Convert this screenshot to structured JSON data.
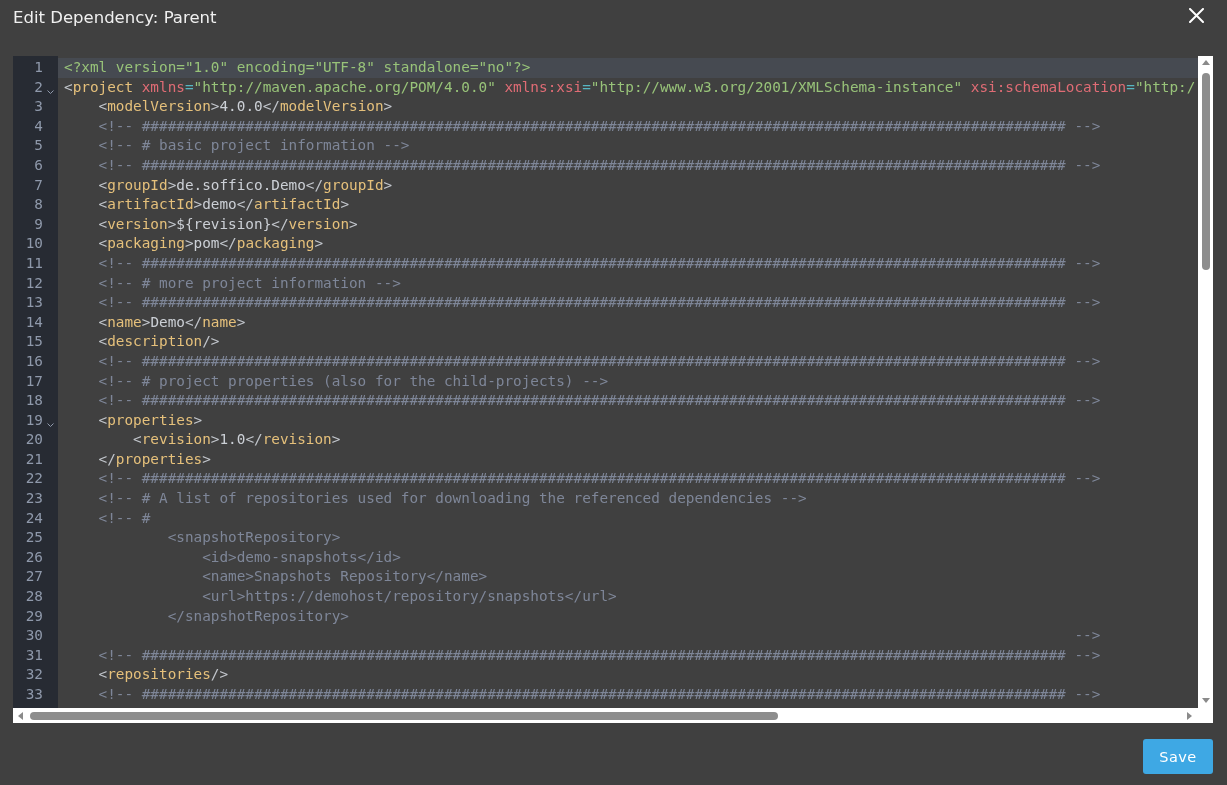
{
  "dialog": {
    "title": "Edit Dependency: Parent"
  },
  "editor": {
    "lines": [
      {
        "number": "1",
        "current": true,
        "foldable": false,
        "tokens": [
          {
            "kind": "declaration",
            "text": "<?xml version=\"1.0\" encoding=\"UTF-8\" standalone=\"no\"?>"
          }
        ]
      },
      {
        "number": "2",
        "current": false,
        "foldable": true,
        "tokens": [
          {
            "kind": "bracket",
            "text": "<"
          },
          {
            "kind": "tag",
            "text": "project"
          },
          {
            "kind": "attr",
            "text": " xmlns"
          },
          {
            "kind": "eq",
            "text": "="
          },
          {
            "kind": "value",
            "text": "\"http://maven.apache.org/POM/4.0.0\""
          },
          {
            "kind": "attr",
            "text": " xmlns:xsi"
          },
          {
            "kind": "eq",
            "text": "="
          },
          {
            "kind": "value",
            "text": "\"http://www.w3.org/2001/XMLSchema-instance\""
          },
          {
            "kind": "attr",
            "text": " xsi:schemaLocation"
          },
          {
            "kind": "eq",
            "text": "="
          },
          {
            "kind": "value",
            "text": "\"http:/"
          }
        ]
      },
      {
        "number": "3",
        "current": false,
        "foldable": false,
        "tokens": [
          {
            "kind": "bracket",
            "text": "    <"
          },
          {
            "kind": "tag",
            "text": "modelVersion"
          },
          {
            "kind": "bracket",
            "text": ">"
          },
          {
            "kind": "text",
            "text": "4.0.0"
          },
          {
            "kind": "bracket",
            "text": "</"
          },
          {
            "kind": "tag",
            "text": "modelVersion"
          },
          {
            "kind": "bracket",
            "text": ">"
          }
        ]
      },
      {
        "number": "4",
        "current": false,
        "foldable": false,
        "tokens": [
          {
            "kind": "comment",
            "text": "    <!-- ########################################################################################################### -->"
          }
        ]
      },
      {
        "number": "5",
        "current": false,
        "foldable": false,
        "tokens": [
          {
            "kind": "comment",
            "text": "    <!-- # basic project information -->"
          }
        ]
      },
      {
        "number": "6",
        "current": false,
        "foldable": false,
        "tokens": [
          {
            "kind": "comment",
            "text": "    <!-- ########################################################################################################### -->"
          }
        ]
      },
      {
        "number": "7",
        "current": false,
        "foldable": false,
        "tokens": [
          {
            "kind": "bracket",
            "text": "    <"
          },
          {
            "kind": "tag",
            "text": "groupId"
          },
          {
            "kind": "bracket",
            "text": ">"
          },
          {
            "kind": "text",
            "text": "de.soffico.Demo"
          },
          {
            "kind": "bracket",
            "text": "</"
          },
          {
            "kind": "tag",
            "text": "groupId"
          },
          {
            "kind": "bracket",
            "text": ">"
          }
        ]
      },
      {
        "number": "8",
        "current": false,
        "foldable": false,
        "tokens": [
          {
            "kind": "bracket",
            "text": "    <"
          },
          {
            "kind": "tag",
            "text": "artifactId"
          },
          {
            "kind": "bracket",
            "text": ">"
          },
          {
            "kind": "text",
            "text": "demo"
          },
          {
            "kind": "bracket",
            "text": "</"
          },
          {
            "kind": "tag",
            "text": "artifactId"
          },
          {
            "kind": "bracket",
            "text": ">"
          }
        ]
      },
      {
        "number": "9",
        "current": false,
        "foldable": false,
        "tokens": [
          {
            "kind": "bracket",
            "text": "    <"
          },
          {
            "kind": "tag",
            "text": "version"
          },
          {
            "kind": "bracket",
            "text": ">"
          },
          {
            "kind": "text",
            "text": "${revision}"
          },
          {
            "kind": "bracket",
            "text": "</"
          },
          {
            "kind": "tag",
            "text": "version"
          },
          {
            "kind": "bracket",
            "text": ">"
          }
        ]
      },
      {
        "number": "10",
        "current": false,
        "foldable": false,
        "tokens": [
          {
            "kind": "bracket",
            "text": "    <"
          },
          {
            "kind": "tag",
            "text": "packaging"
          },
          {
            "kind": "bracket",
            "text": ">"
          },
          {
            "kind": "text",
            "text": "pom"
          },
          {
            "kind": "bracket",
            "text": "</"
          },
          {
            "kind": "tag",
            "text": "packaging"
          },
          {
            "kind": "bracket",
            "text": ">"
          }
        ]
      },
      {
        "number": "11",
        "current": false,
        "foldable": false,
        "tokens": [
          {
            "kind": "comment",
            "text": "    <!-- ########################################################################################################### -->"
          }
        ]
      },
      {
        "number": "12",
        "current": false,
        "foldable": false,
        "tokens": [
          {
            "kind": "comment",
            "text": "    <!-- # more project information -->"
          }
        ]
      },
      {
        "number": "13",
        "current": false,
        "foldable": false,
        "tokens": [
          {
            "kind": "comment",
            "text": "    <!-- ########################################################################################################### -->"
          }
        ]
      },
      {
        "number": "14",
        "current": false,
        "foldable": false,
        "tokens": [
          {
            "kind": "bracket",
            "text": "    <"
          },
          {
            "kind": "tag",
            "text": "name"
          },
          {
            "kind": "bracket",
            "text": ">"
          },
          {
            "kind": "text",
            "text": "Demo"
          },
          {
            "kind": "bracket",
            "text": "</"
          },
          {
            "kind": "tag",
            "text": "name"
          },
          {
            "kind": "bracket",
            "text": ">"
          }
        ]
      },
      {
        "number": "15",
        "current": false,
        "foldable": false,
        "tokens": [
          {
            "kind": "bracket",
            "text": "    <"
          },
          {
            "kind": "tag",
            "text": "description"
          },
          {
            "kind": "bracket",
            "text": "/>"
          }
        ]
      },
      {
        "number": "16",
        "current": false,
        "foldable": false,
        "tokens": [
          {
            "kind": "comment",
            "text": "    <!-- ########################################################################################################### -->"
          }
        ]
      },
      {
        "number": "17",
        "current": false,
        "foldable": false,
        "tokens": [
          {
            "kind": "comment",
            "text": "    <!-- # project properties (also for the child-projects) -->"
          }
        ]
      },
      {
        "number": "18",
        "current": false,
        "foldable": false,
        "tokens": [
          {
            "kind": "comment",
            "text": "    <!-- ########################################################################################################### -->"
          }
        ]
      },
      {
        "number": "19",
        "current": false,
        "foldable": true,
        "tokens": [
          {
            "kind": "bracket",
            "text": "    <"
          },
          {
            "kind": "tag",
            "text": "properties"
          },
          {
            "kind": "bracket",
            "text": ">"
          }
        ]
      },
      {
        "number": "20",
        "current": false,
        "foldable": false,
        "tokens": [
          {
            "kind": "bracket",
            "text": "        <"
          },
          {
            "kind": "tag",
            "text": "revision"
          },
          {
            "kind": "bracket",
            "text": ">"
          },
          {
            "kind": "text",
            "text": "1.0"
          },
          {
            "kind": "bracket",
            "text": "</"
          },
          {
            "kind": "tag",
            "text": "revision"
          },
          {
            "kind": "bracket",
            "text": ">"
          }
        ]
      },
      {
        "number": "21",
        "current": false,
        "foldable": false,
        "tokens": [
          {
            "kind": "bracket",
            "text": "    </"
          },
          {
            "kind": "tag",
            "text": "properties"
          },
          {
            "kind": "bracket",
            "text": ">"
          }
        ]
      },
      {
        "number": "22",
        "current": false,
        "foldable": false,
        "tokens": [
          {
            "kind": "comment",
            "text": "    <!-- ########################################################################################################### -->"
          }
        ]
      },
      {
        "number": "23",
        "current": false,
        "foldable": false,
        "tokens": [
          {
            "kind": "comment",
            "text": "    <!-- # A list of repositories used for downloading the referenced dependencies -->"
          }
        ]
      },
      {
        "number": "24",
        "current": false,
        "foldable": false,
        "tokens": [
          {
            "kind": "comment",
            "text": "    <!-- #"
          }
        ]
      },
      {
        "number": "25",
        "current": false,
        "foldable": false,
        "tokens": [
          {
            "kind": "comment",
            "text": "            <snapshotRepository>"
          }
        ]
      },
      {
        "number": "26",
        "current": false,
        "foldable": false,
        "tokens": [
          {
            "kind": "comment",
            "text": "                <id>demo-snapshots</id>"
          }
        ]
      },
      {
        "number": "27",
        "current": false,
        "foldable": false,
        "tokens": [
          {
            "kind": "comment",
            "text": "                <name>Snapshots Repository</name>"
          }
        ]
      },
      {
        "number": "28",
        "current": false,
        "foldable": false,
        "tokens": [
          {
            "kind": "comment",
            "text": "                <url>https://demohost/repository/snapshots</url>"
          }
        ]
      },
      {
        "number": "29",
        "current": false,
        "foldable": false,
        "tokens": [
          {
            "kind": "comment",
            "text": "            </snapshotRepository>"
          }
        ]
      },
      {
        "number": "30",
        "current": false,
        "foldable": false,
        "tokens": [
          {
            "kind": "comment",
            "text": "                                                                                                                     -->"
          }
        ]
      },
      {
        "number": "31",
        "current": false,
        "foldable": false,
        "tokens": [
          {
            "kind": "comment",
            "text": "    <!-- ########################################################################################################### -->"
          }
        ]
      },
      {
        "number": "32",
        "current": false,
        "foldable": false,
        "tokens": [
          {
            "kind": "bracket",
            "text": "    <"
          },
          {
            "kind": "tag",
            "text": "repositories"
          },
          {
            "kind": "bracket",
            "text": "/>"
          }
        ]
      },
      {
        "number": "33",
        "current": false,
        "foldable": false,
        "tokens": [
          {
            "kind": "comment",
            "text": "    <!-- ########################################################################################################### -->"
          }
        ]
      }
    ]
  },
  "footer": {
    "save_button": "Save"
  }
}
